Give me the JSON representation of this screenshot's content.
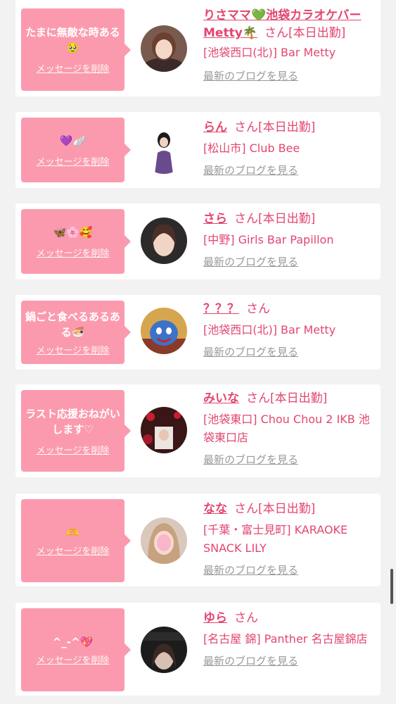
{
  "entries": [
    {
      "message": "たまに無敵な時ある🥹",
      "delete_label": "メッセージを削除",
      "name": "りさママ💚池袋カラオケバーMetty🌴",
      "honorific": "さん",
      "status": "[本日出勤]",
      "shop": "[池袋西口(北)] Bar Metty",
      "blog_label": "最新のブログを見る"
    },
    {
      "message": "💜🪽",
      "delete_label": "メッセージを削除",
      "name": "らん",
      "honorific": "さん",
      "status": "[本日出勤]",
      "shop": "[松山市] Club Bee",
      "blog_label": "最新のブログを見る"
    },
    {
      "message": "🦋🌸🥰",
      "delete_label": "メッセージを削除",
      "name": "さら",
      "honorific": "さん",
      "status": "[本日出勤]",
      "shop": "[中野] Girls Bar Papillon",
      "blog_label": "最新のブログを見る"
    },
    {
      "message": "鍋ごと食べるあるある🍜",
      "delete_label": "メッセージを削除",
      "name": "？？？",
      "honorific": "さん",
      "status": "",
      "shop": "[池袋西口(北)] Bar Metty",
      "blog_label": "最新のブログを見る"
    },
    {
      "message": "ラスト応援おねがいします♡",
      "delete_label": "メッセージを削除",
      "name": "みいな",
      "honorific": "さん",
      "status": "[本日出勤]",
      "shop": "[池袋東口] Chou Chou 2 IKB 池袋東口店",
      "blog_label": "最新のブログを見る"
    },
    {
      "message": "🫶",
      "delete_label": "メッセージを削除",
      "name": "なな",
      "honorific": "さん",
      "status": "[本日出勤]",
      "shop": "[千葉・富士見町] KARAOKE SNACK LILY",
      "blog_label": "最新のブログを見る"
    },
    {
      "message": "^_-^💖",
      "delete_label": "メッセージを削除",
      "name": "ゆら",
      "honorific": "さん",
      "status": "",
      "shop": "[名古屋 錦] Panther 名古屋錦店",
      "blog_label": "最新のブログを見る"
    }
  ],
  "colors": {
    "bubble": "#fb9aae",
    "accent": "#e24670",
    "link_gray": "#9a9a9a",
    "background": "#f2f2f2"
  }
}
